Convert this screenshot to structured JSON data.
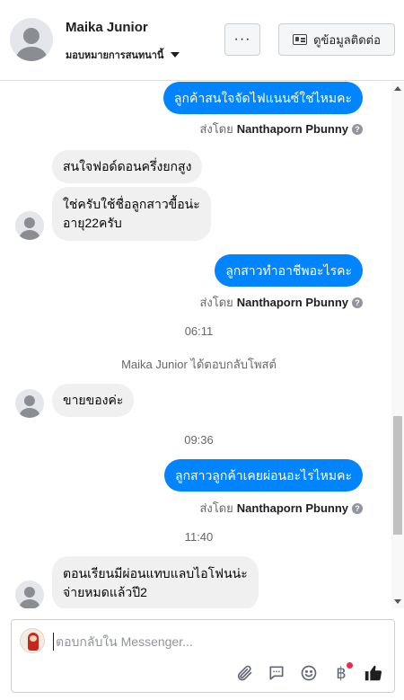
{
  "header": {
    "contact_name": "Maika Junior",
    "assign_label": "มอบหมายการสนทนานี้",
    "more_label": "···",
    "info_label": "ดูข้อมูลติดต่อ"
  },
  "messages": {
    "m1": {
      "text": "ลูกค้าสนใจจัดไฟแนนซ์ใช่ไหมคะ"
    },
    "m1_sent": {
      "prefix": "ส่งโดย",
      "sender": "Nanthaporn Pbunny"
    },
    "m2": {
      "text": "สนใจฟอด์ดอนครึ่งยกสูง"
    },
    "m3": {
      "line1": "ใช่ครับใช้ชื่อลูกสาวขื้อน่ะ",
      "line2": "อายุ22ครับ"
    },
    "m4": {
      "text": "ลูกสาวทำอาชีพอะไรคะ"
    },
    "m4_sent": {
      "prefix": "ส่งโดย",
      "sender": "Nanthaporn Pbunny"
    },
    "time1": "06:11",
    "system1": "Maika Junior ได้ตอบกลับโพสต์",
    "m5": {
      "text": "ขายของค่ะ"
    },
    "time2": "09:36",
    "m6": {
      "text": "ลูกสาวลูกค้าเคยผ่อนอะไรไหมคะ"
    },
    "m6_sent": {
      "prefix": "ส่งโดย",
      "sender": "Nanthaporn Pbunny"
    },
    "time3": "11:40",
    "m7": {
      "line1": "ตอนเรียนมีผ่อนแทบแลบไอโฟนน่ะ",
      "line2": "จ่ายหมดแล้วปี2"
    }
  },
  "composer": {
    "placeholder": "ตอบกลับใน Messenger..."
  },
  "icons": {
    "help": "?",
    "currency": "฿"
  },
  "colors": {
    "outgoing_bubble": "#0084ff",
    "incoming_bubble": "#f0f0f0",
    "like_icon": "#1c1e21",
    "notification_dot": "#f02849"
  }
}
